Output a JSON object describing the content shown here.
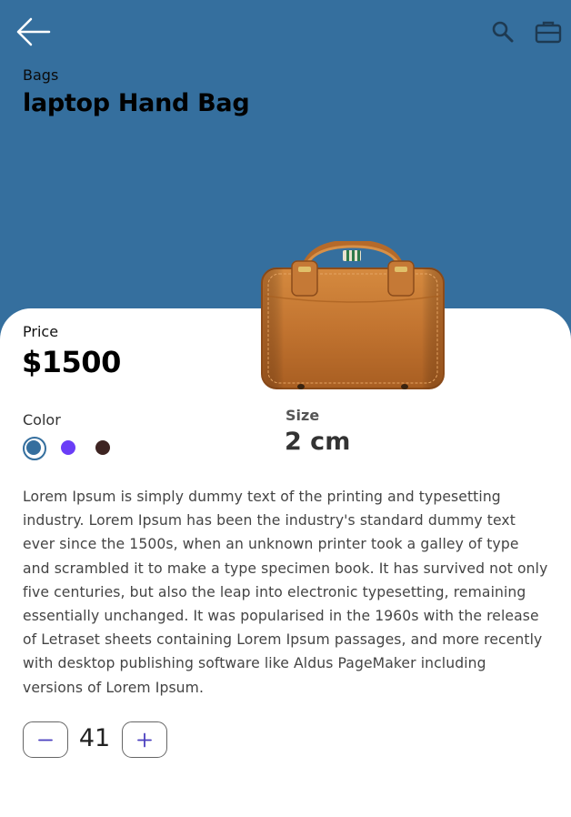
{
  "app": {
    "accent_color": "#356f9e",
    "icons": {
      "back": "arrow-back-icon",
      "search": "search-icon",
      "cart": "briefcase-icon"
    }
  },
  "product": {
    "category": "Bags",
    "title": "laptop Hand Bag",
    "price_label": "Price",
    "price": "$1500",
    "color_label": "Color",
    "colors": [
      "#356f9e",
      "#6a3df7",
      "#3e2422"
    ],
    "selected_color": "#356f9e",
    "size_label": "Size",
    "size": "2 cm",
    "description": "Lorem Ipsum is simply dummy text of the printing and typesetting industry. Lorem Ipsum has been the industry's standard dummy text ever since the 1500s, when an unknown printer took a galley of type and scrambled it to make a type specimen book. It has survived not only five centuries, but also the leap into electronic typesetting, remaining essentially unchanged. It was popularised in the 1960s with the release of Letraset sheets containing Lorem Ipsum passages, and more recently with desktop publishing software like Aldus PageMaker including versions of Lorem Ipsum."
  },
  "quantity": {
    "value": "41",
    "minus_label": "−",
    "plus_label": "+"
  }
}
